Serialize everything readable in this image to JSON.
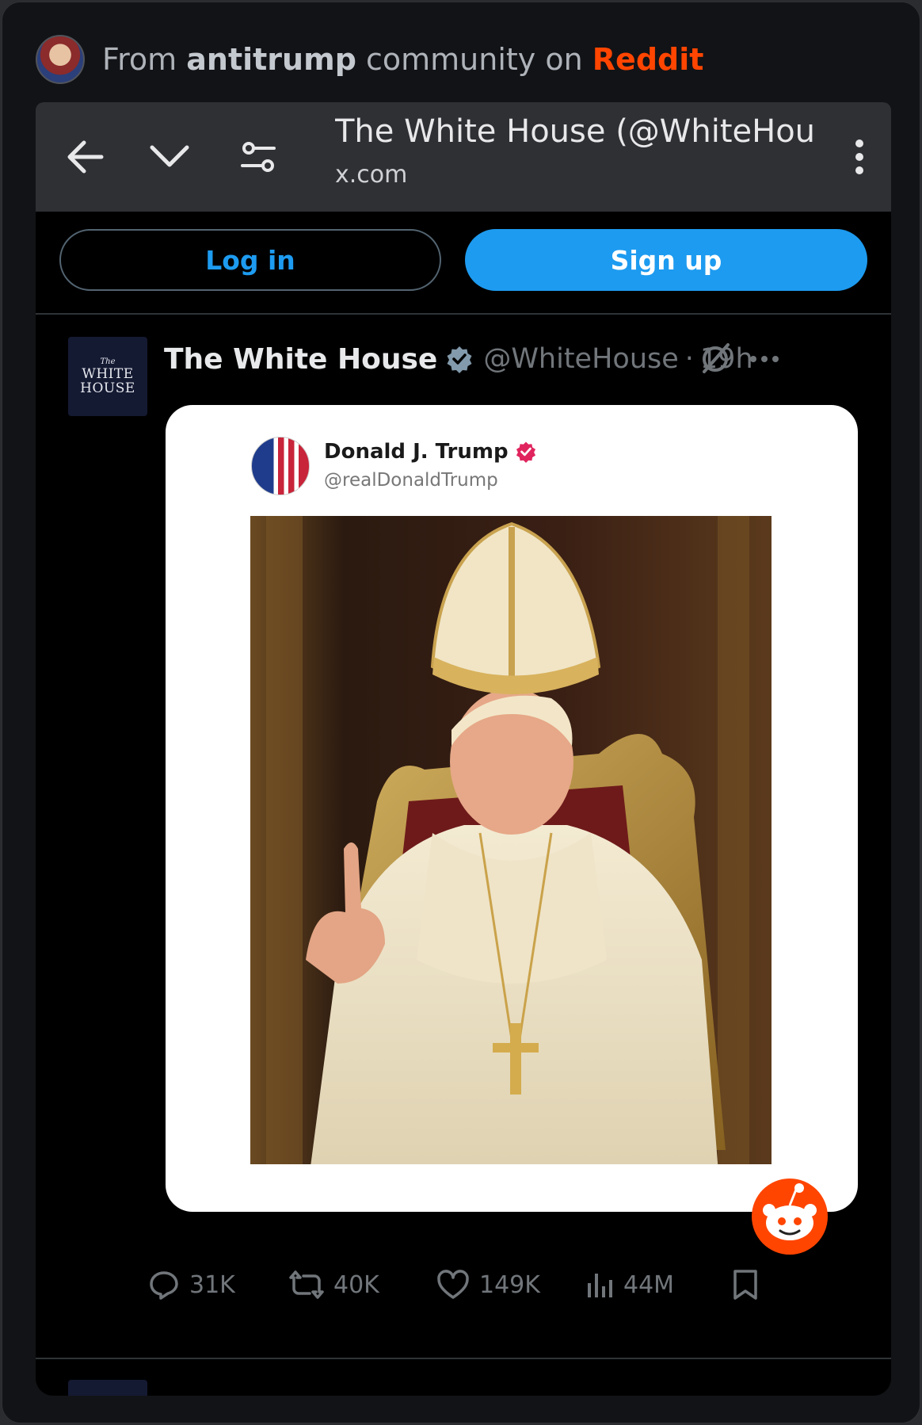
{
  "reddit_header": {
    "from": "From",
    "community": "antitrump",
    "community_on": "community on",
    "platform": "Reddit"
  },
  "browser": {
    "page_title": "The White House (@WhiteHou...",
    "domain": "x.com",
    "icons": [
      "back-arrow-icon",
      "chevron-down-icon",
      "site-settings-icon",
      "kebab-menu-icon"
    ]
  },
  "auth": {
    "login_label": "Log in",
    "signup_label": "Sign up"
  },
  "tweet": {
    "author_name": "The White House",
    "handle": "@WhiteHouse",
    "separator": "·",
    "time": "19h",
    "avatar_small": "The",
    "avatar_line1": "WHITE",
    "avatar_line2": "HOUSE",
    "embedded": {
      "name": "Donald J. Trump",
      "handle": "@realDonaldTrump"
    },
    "stats": {
      "replies": "31K",
      "reposts": "40K",
      "likes": "149K",
      "views": "44M"
    }
  },
  "colors": {
    "reddit_orange": "#ff4500",
    "x_blue": "#1d9bf0",
    "muted": "#71767b"
  }
}
